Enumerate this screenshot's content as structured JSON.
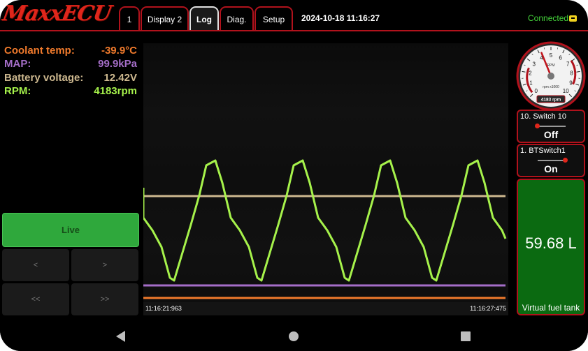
{
  "app": {
    "logo": "MaxxECU"
  },
  "tabs": [
    {
      "label": "1",
      "active": false
    },
    {
      "label": "Display 2",
      "active": false
    },
    {
      "label": "Log",
      "active": true
    },
    {
      "label": "Diag.",
      "active": false
    },
    {
      "label": "Setup",
      "active": false
    }
  ],
  "status": {
    "datetime": "2024-10-18 11:16:27",
    "connection": "Connected",
    "connection_icon": "plug-icon"
  },
  "readings": [
    {
      "label": "Coolant temp:",
      "value": "-39.9°C",
      "color": "#f07a2c"
    },
    {
      "label": "MAP:",
      "value": "99.9kPa",
      "color": "#a56ec8"
    },
    {
      "label": "Battery voltage:",
      "value": "12.42V",
      "color": "#cdb88f"
    },
    {
      "label": "RPM:",
      "value": "4183rpm",
      "color": "#a6f24b"
    }
  ],
  "controls": {
    "live": "Live",
    "prev": "<",
    "next": ">",
    "rewind": "<<",
    "forward": ">>"
  },
  "chart_data": {
    "type": "line",
    "x_start_label": "11:16:21:963",
    "x_end_label": "11:16:27:475",
    "grid": false,
    "series": [
      {
        "color": "#a6f24b",
        "shape": "rpm-waveform",
        "peaks": 5
      },
      {
        "color": "#cdb88f",
        "shape": "flat"
      },
      {
        "color": "#a56ec8",
        "shape": "flat"
      },
      {
        "color": "#f07a2c",
        "shape": "flat"
      }
    ]
  },
  "gauge": {
    "ticks": [
      "0",
      "1",
      "2",
      "3",
      "4",
      "5",
      "6",
      "7",
      "8",
      "9",
      "10"
    ],
    "unit": "RPM",
    "multiplier": "rpm x1000",
    "readout": "4183 rpm",
    "value": 4183,
    "max": 10000,
    "color": "#b1121c"
  },
  "switches": [
    {
      "title": "10. Switch 10",
      "state": "Off",
      "on": false
    },
    {
      "title": "1. BTSwitch1",
      "state": "On",
      "on": true
    }
  ],
  "fuel": {
    "value": "59.68 L",
    "label": "Virtual fuel tank",
    "color": "#0b6a11"
  },
  "android_nav": {
    "back": "back-icon",
    "home": "home-icon",
    "recent": "recent-apps-icon"
  }
}
